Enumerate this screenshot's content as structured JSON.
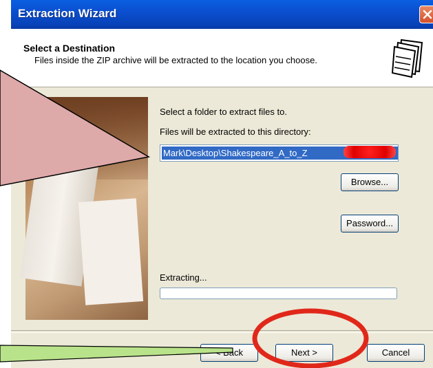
{
  "window": {
    "title": "Extraction Wizard"
  },
  "header": {
    "title": "Select a Destination",
    "subtitle": "Files inside the ZIP archive will be extracted to the location you choose."
  },
  "body": {
    "select_folder_label": "Select a folder to extract files to.",
    "directory_label": "Files will be extracted to this directory:",
    "directory_value": "Mark\\Desktop\\Shakespeare_A_to_Z",
    "browse_label": "Browse...",
    "password_label": "Password...",
    "extracting_label": "Extracting...",
    "progress": 0
  },
  "footer": {
    "back_label": "< Back",
    "next_label": "Next >",
    "cancel_label": "Cancel"
  },
  "colors": {
    "titlebar": "#0a4fd0",
    "annotation_triangle": "#dea9a9",
    "annotation_arrow": "#b9e38a",
    "highlight_oval": "#e0281a"
  },
  "icons": {
    "close": "close-icon",
    "header": "folders-icon"
  }
}
